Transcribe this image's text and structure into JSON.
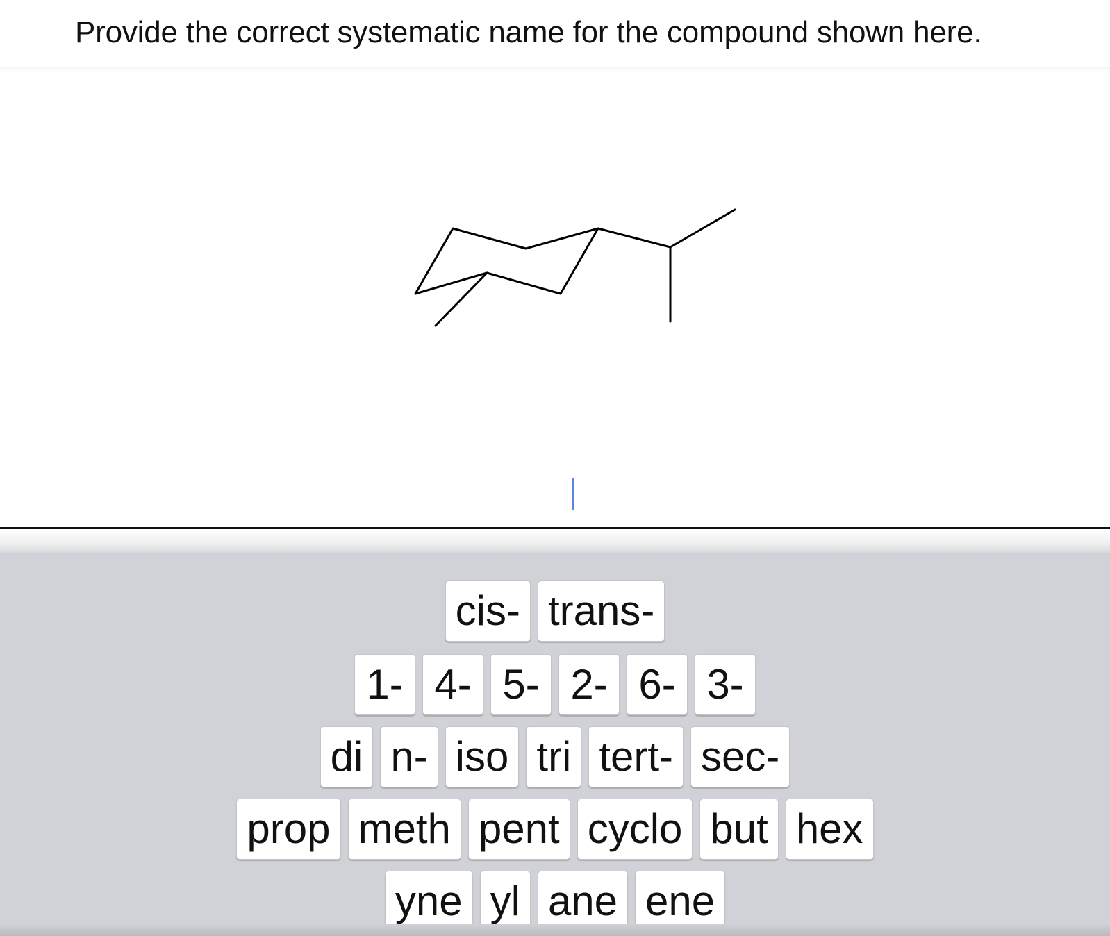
{
  "question": {
    "text": "Provide the correct systematic name for the compound shown here."
  },
  "answer": {
    "value": ""
  },
  "keyboard": {
    "rows": [
      {
        "keys": [
          "cis-",
          "trans-"
        ]
      },
      {
        "keys": [
          "1-",
          "4-",
          "5-",
          "2-",
          "6-",
          "3-"
        ]
      },
      {
        "keys": [
          "di",
          "n-",
          "iso",
          "tri",
          "tert-",
          "sec-"
        ]
      },
      {
        "keys": [
          "prop",
          "meth",
          "pent",
          "cyclo",
          "but",
          "hex"
        ]
      },
      {
        "keys": [
          "yne",
          "yl",
          "ane",
          "ene"
        ]
      }
    ]
  },
  "icons": {
    "structure": "cyclohexane-chair-structure-icon"
  },
  "colors": {
    "keyboard_bg": "#d1d2d7",
    "key_bg": "#ffffff",
    "caret": "#5b86e0",
    "line": "#111111"
  }
}
